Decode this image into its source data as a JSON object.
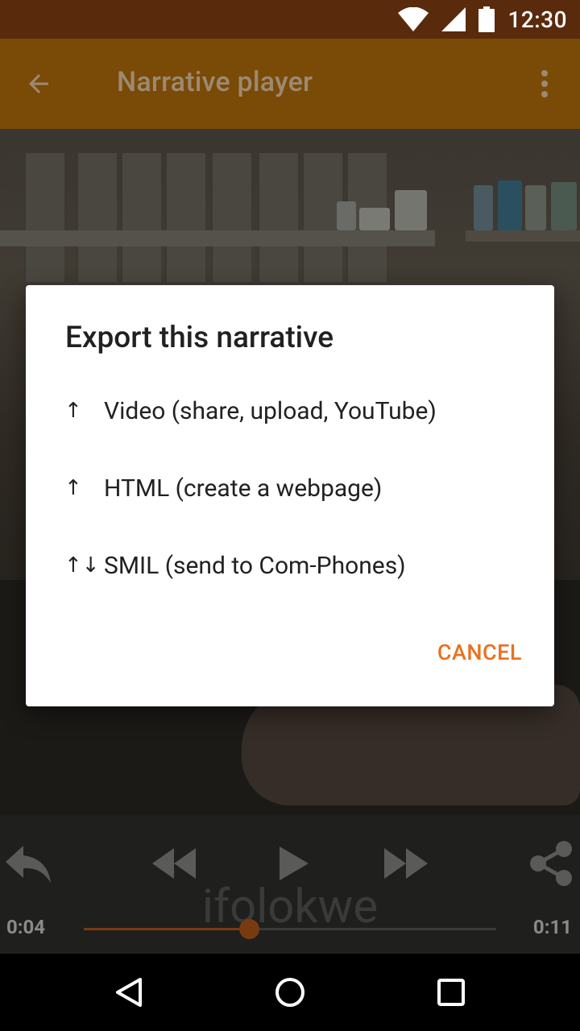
{
  "status_bar": {
    "time": "12:30",
    "icons": [
      "wifi-icon",
      "signal-icon",
      "battery-icon"
    ]
  },
  "app_bar": {
    "title": "Narrative player",
    "back_icon": "arrow-back-icon",
    "menu_icon": "more-vert-icon"
  },
  "dialog": {
    "title": "Export this narrative",
    "items": [
      {
        "arrow": "↑",
        "label": "Video (share, upload, YouTube)"
      },
      {
        "arrow": "↑",
        "label": "HTML (create a webpage)"
      },
      {
        "arrow": "↑↓",
        "label": "SMIL (send to Com-Phones)"
      }
    ],
    "cancel_label": "CANCEL"
  },
  "player": {
    "watermark": "ifolokwe",
    "time_elapsed": "0:04",
    "time_total": "0:11",
    "progress_fraction": 0.4
  },
  "colors": {
    "status_bar": "#5a2a0c",
    "app_bar": "#7a4a07",
    "accent": "#e8711f",
    "seek": "#7a3a10"
  },
  "nav_bar": {
    "icons": [
      "back-triangle-icon",
      "home-circle-icon",
      "recents-square-icon"
    ]
  }
}
